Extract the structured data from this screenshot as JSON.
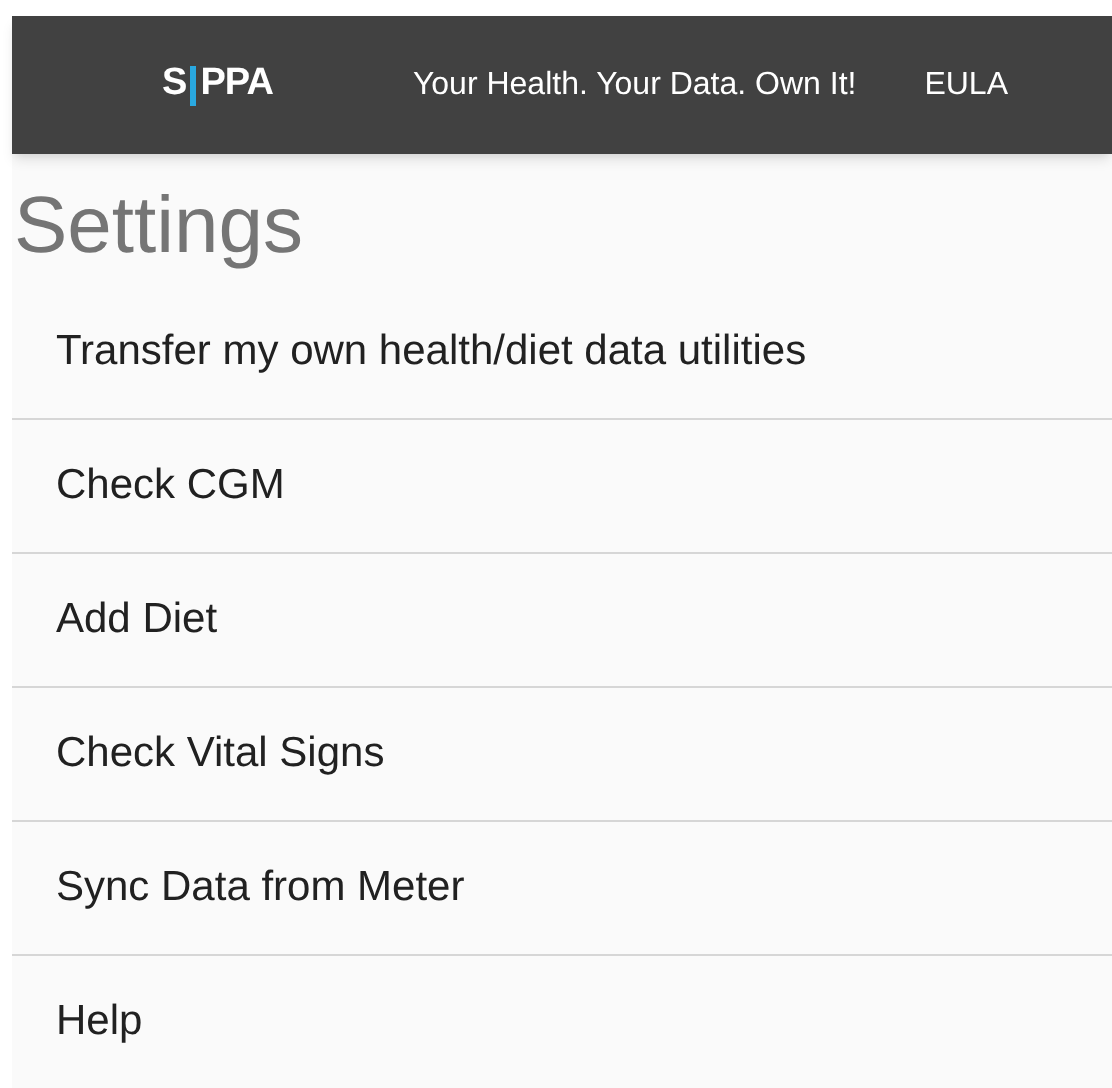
{
  "header": {
    "logo": {
      "left": "S",
      "right": "PPA"
    },
    "tagline": "Your Health. Your Data. Own It!",
    "link": "EULA"
  },
  "title": "Settings",
  "items": [
    {
      "label": "Transfer my own health/diet data utilities"
    },
    {
      "label": "Check CGM"
    },
    {
      "label": "Add Diet"
    },
    {
      "label": "Check Vital Signs"
    },
    {
      "label": "Sync Data from Meter"
    },
    {
      "label": "Help"
    }
  ]
}
